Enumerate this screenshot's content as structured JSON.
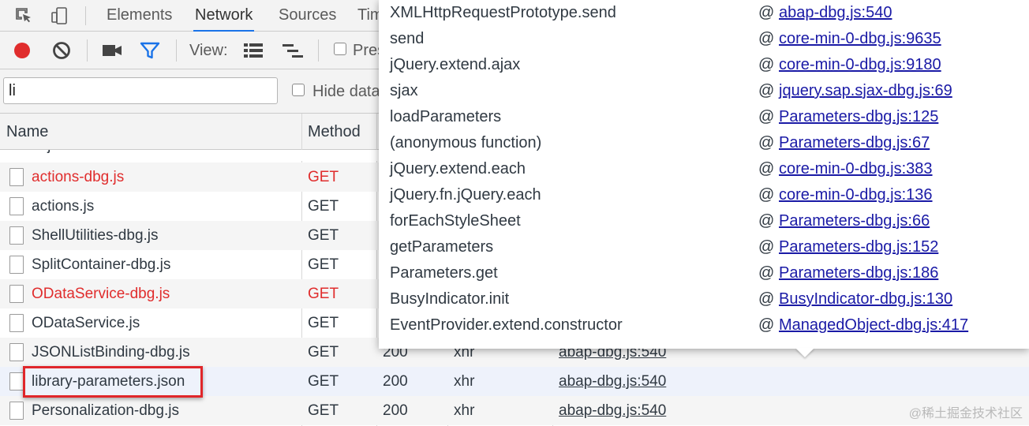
{
  "tabs": [
    "Elements",
    "Network",
    "Sources",
    "Tim"
  ],
  "active_tab": "Network",
  "toolbar": {
    "view_label": "View:",
    "preserve_log_label": "Pres"
  },
  "filter": {
    "value": "li",
    "hide_data_label": "Hide data"
  },
  "table": {
    "headers": {
      "name": "Name",
      "method": "Method"
    },
    "partial_top": {
      "name": "ui.js",
      "method": "GET"
    },
    "rows": [
      {
        "name": "actions-dbg.js",
        "method": "GET",
        "status": "",
        "type": "",
        "initiator": "",
        "error": true
      },
      {
        "name": "actions.js",
        "method": "GET",
        "status": "",
        "type": "",
        "initiator": "",
        "error": false
      },
      {
        "name": "ShellUtilities-dbg.js",
        "method": "GET",
        "status": "",
        "type": "",
        "initiator": "",
        "error": false
      },
      {
        "name": "SplitContainer-dbg.js",
        "method": "GET",
        "status": "",
        "type": "",
        "initiator": "",
        "error": false
      },
      {
        "name": "ODataService-dbg.js",
        "method": "GET",
        "status": "",
        "type": "",
        "initiator": "",
        "error": true
      },
      {
        "name": "ODataService.js",
        "method": "GET",
        "status": "",
        "type": "",
        "initiator": "",
        "error": false
      },
      {
        "name": "JSONListBinding-dbg.js",
        "method": "GET",
        "status": "200",
        "type": "xhr",
        "initiator": "abap-dbg.js:540",
        "error": false
      },
      {
        "name": "library-parameters.json",
        "method": "GET",
        "status": "200",
        "type": "xhr",
        "initiator": "abap-dbg.js:540",
        "error": false
      },
      {
        "name": "Personalization-dbg.js",
        "method": "GET",
        "status": "200",
        "type": "xhr",
        "initiator": "abap-dbg.js:540",
        "error": false
      }
    ]
  },
  "stack": {
    "at_symbol": "@",
    "frames": [
      {
        "fn": "XMLHttpRequestPrototype.send",
        "src": "abap-dbg.js:540"
      },
      {
        "fn": "send",
        "src": "core-min-0-dbg.js:9635"
      },
      {
        "fn": "jQuery.extend.ajax",
        "src": "core-min-0-dbg.js:9180"
      },
      {
        "fn": "sjax",
        "src": "jquery.sap.sjax-dbg.js:69"
      },
      {
        "fn": "loadParameters",
        "src": "Parameters-dbg.js:125"
      },
      {
        "fn": "(anonymous function)",
        "src": "Parameters-dbg.js:67"
      },
      {
        "fn": "jQuery.extend.each",
        "src": "core-min-0-dbg.js:383"
      },
      {
        "fn": "jQuery.fn.jQuery.each",
        "src": "core-min-0-dbg.js:136"
      },
      {
        "fn": "forEachStyleSheet",
        "src": "Parameters-dbg.js:66"
      },
      {
        "fn": "getParameters",
        "src": "Parameters-dbg.js:152"
      },
      {
        "fn": "Parameters.get",
        "src": "Parameters-dbg.js:186"
      },
      {
        "fn": "BusyIndicator.init",
        "src": "BusyIndicator-dbg.js:130"
      },
      {
        "fn": "EventProvider.extend.constructor",
        "src": "ManagedObject-dbg.js:417"
      }
    ]
  },
  "watermark": "@稀土掘金技术社区"
}
